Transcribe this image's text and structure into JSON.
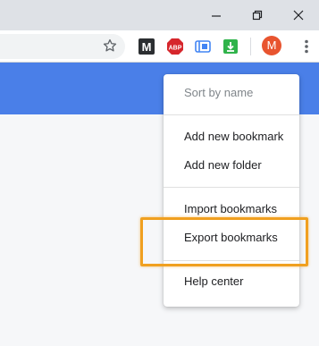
{
  "browser": {
    "extensions": [
      {
        "name": "M extension",
        "label": "M"
      },
      {
        "name": "Adblock Plus",
        "label": "ABP"
      },
      {
        "name": "extension-blue",
        "label": ""
      },
      {
        "name": "extension-download",
        "label": ""
      }
    ],
    "profile_initial": "M",
    "colors": {
      "accent": "#4a7fe8",
      "profile": "#e8542f",
      "abp": "#d6262c",
      "download": "#2fb34a",
      "highlight": "#f0a020"
    }
  },
  "menu": {
    "sort_label": "Sort by name",
    "add_bookmark_label": "Add new bookmark",
    "add_folder_label": "Add new folder",
    "import_label": "Import bookmarks",
    "export_label": "Export bookmarks",
    "help_label": "Help center"
  }
}
